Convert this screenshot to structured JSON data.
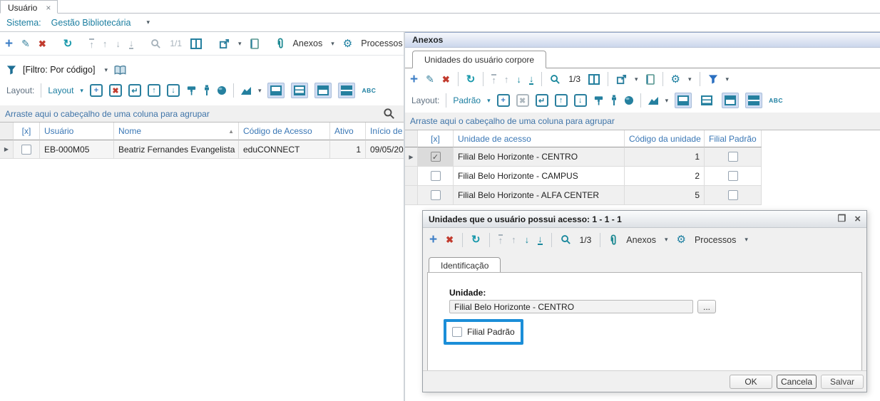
{
  "window": {
    "doc_tab": "Usuário",
    "sistema_label": "Sistema:",
    "sistema_value": "Gestão Bibliotecária"
  },
  "icons": {
    "caret_down": "▾",
    "close": "×",
    "maximize": "❐",
    "plus": "+",
    "pencil": "✎",
    "delete": "✖",
    "refresh": "↻",
    "up": "↑",
    "down": "↓",
    "enter": "↵",
    "row_marker": "▶",
    "sort_asc": "▲",
    "check": "✓",
    "abc": "ABC"
  },
  "colors": {
    "accent_teal": "#1b7ea0",
    "accent_blue": "#3d7ec6",
    "danger_red": "#c23b2e",
    "header_text_blue": "#3a77b5",
    "highlight_blue": "#1b8ed8"
  },
  "left_panel": {
    "toolbar": {
      "pagination": "1/1",
      "anexos_label": "Anexos",
      "processos_label": "Processos"
    },
    "filter": {
      "label": "[Filtro: Por código]"
    },
    "layout": {
      "label": "Layout:",
      "selector": "Layout"
    },
    "group_hint": "Arraste aqui o cabeçalho de uma coluna para agrupar",
    "grid": {
      "headers": [
        "[x]",
        "Usuário",
        "Nome",
        "Código de Acesso",
        "Ativo",
        "Início de V"
      ],
      "rows": [
        {
          "usuario": "EB-000M05",
          "nome": "Beatriz Fernandes Evangelista",
          "codigo_acesso": "eduCONNECT",
          "ativo": "1",
          "inicio_vigencia": "09/05/20"
        }
      ]
    }
  },
  "right_panel": {
    "title": "Anexos",
    "tab": "Unidades do usuário corpore",
    "toolbar": {
      "pagination": "1/3"
    },
    "layout": {
      "label": "Layout:",
      "selector": "Padrão"
    },
    "group_hint": "Arraste aqui o cabeçalho de uma coluna para agrupar",
    "grid": {
      "headers": [
        "[x]",
        "Unidade de acesso",
        "Código da unidade",
        "Filial Padrão"
      ],
      "rows": [
        {
          "unidade": "Filial Belo Horizonte - CENTRO",
          "codigo": "1",
          "selected": true
        },
        {
          "unidade": "Filial Belo Horizonte - CAMPUS",
          "codigo": "2",
          "selected": false
        },
        {
          "unidade": "Filial Belo Horizonte - ALFA CENTER",
          "codigo": "5",
          "selected": false
        }
      ]
    }
  },
  "dialog": {
    "title": "Unidades que o usuário possui acesso: 1 - 1 - 1",
    "toolbar": {
      "pagination": "1/3",
      "anexos_label": "Anexos",
      "processos_label": "Processos"
    },
    "tab": "Identificação",
    "form": {
      "unidade_label": "Unidade:",
      "unidade_value": "Filial Belo Horizonte - CENTRO",
      "browse_label": "...",
      "checkbox_label": "Filial Padrão"
    },
    "buttons": {
      "ok": "OK",
      "cancel": "Cancela",
      "save": "Salvar"
    }
  }
}
